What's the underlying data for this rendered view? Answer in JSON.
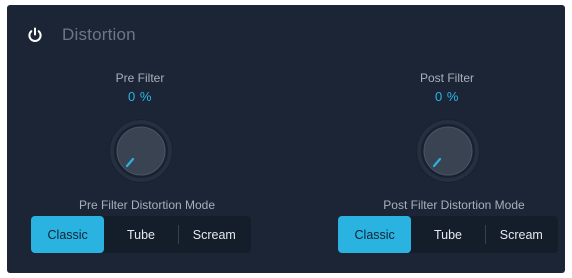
{
  "header": {
    "title": "Distortion"
  },
  "pre": {
    "label": "Pre Filter",
    "value": "0 %",
    "mode_label": "Pre Filter Distortion Mode",
    "options": [
      "Classic",
      "Tube",
      "Scream"
    ],
    "selected": "Classic"
  },
  "post": {
    "label": "Post Filter",
    "value": "0 %",
    "mode_label": "Post Filter Distortion Mode",
    "options": [
      "Classic",
      "Tube",
      "Scream"
    ],
    "selected": "Classic"
  },
  "colors": {
    "panel": "#1b2535",
    "accent": "#2ab3e0",
    "value_text": "#27b6e6"
  }
}
